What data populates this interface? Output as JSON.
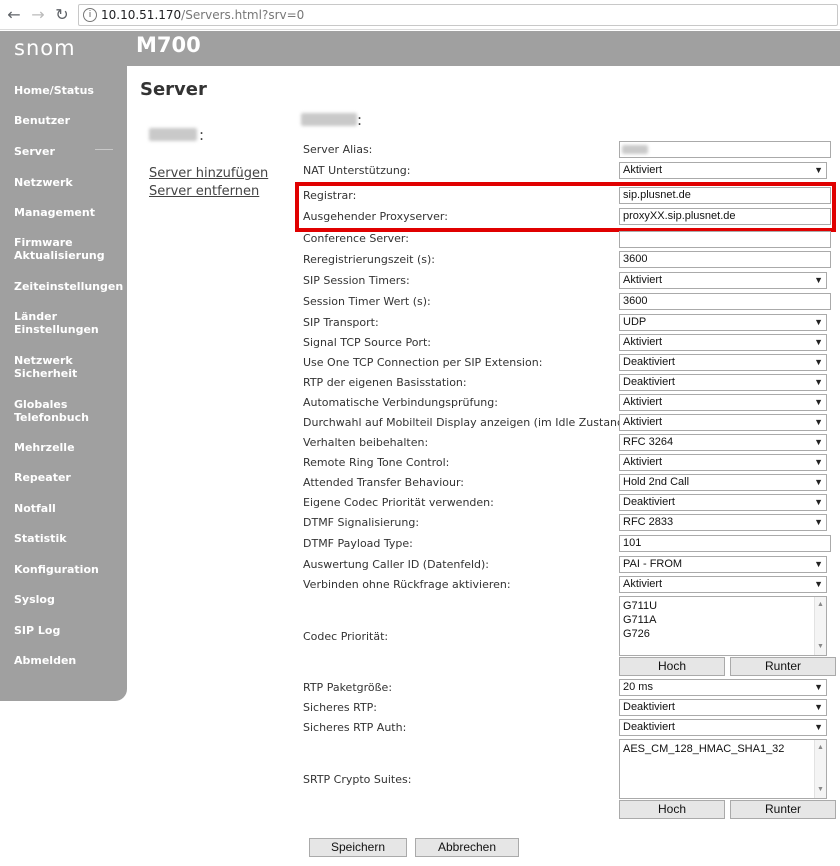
{
  "browser": {
    "back_icon": "arrow-left-icon",
    "forward_icon": "arrow-right-icon",
    "reload_icon": "reload-icon",
    "url_host": "10.10.51.170",
    "url_path": "/Servers.html?srv=0"
  },
  "header": {
    "logo": "snom",
    "model": "M700"
  },
  "sidebar": {
    "items": [
      {
        "label": "Home/Status"
      },
      {
        "label": "Benutzer"
      },
      {
        "label": "Server"
      },
      {
        "label": "Netzwerk"
      },
      {
        "label": "Management"
      },
      {
        "label": "Firmware",
        "label2": "Aktualisierung"
      },
      {
        "label": "Zeiteinstellungen"
      },
      {
        "label": "Länder",
        "label2": "Einstellungen"
      },
      {
        "label": "Netzwerk",
        "label2": "Sicherheit"
      },
      {
        "label": "Globales",
        "label2": "Telefonbuch"
      },
      {
        "label": "Mehrzelle"
      },
      {
        "label": "Repeater"
      },
      {
        "label": "Notfall"
      },
      {
        "label": "Statistik"
      },
      {
        "label": "Konfiguration"
      },
      {
        "label": "Syslog"
      },
      {
        "label": "SIP Log"
      },
      {
        "label": "Abmelden"
      }
    ]
  },
  "main": {
    "title": "Server",
    "links": {
      "add": "Server hinzufügen",
      "remove": "Server entfernen"
    },
    "colon": ":",
    "rows": {
      "server_alias": {
        "label": "Server Alias:",
        "value": ""
      },
      "nat": {
        "label": "NAT Unterstützung:",
        "value": "Aktiviert"
      },
      "registrar": {
        "label": "Registrar:",
        "value": "sip.plusnet.de"
      },
      "proxy": {
        "label": "Ausgehender Proxyserver:",
        "value": "proxyXX.sip.plusnet.de"
      },
      "conference": {
        "label": "Conference Server:",
        "value": ""
      },
      "rereg": {
        "label": "Reregistrierungszeit (s):",
        "value": "3600"
      },
      "sip_session_timers": {
        "label": "SIP Session Timers:",
        "value": "Aktiviert"
      },
      "session_timer_value": {
        "label": "Session Timer Wert (s):",
        "value": "3600"
      },
      "sip_transport": {
        "label": "SIP Transport:",
        "value": "UDP"
      },
      "tcp_source_port": {
        "label": "Signal TCP Source Port:",
        "value": "Aktiviert"
      },
      "one_tcp": {
        "label": "Use One TCP Connection per SIP Extension:",
        "value": "Deaktiviert"
      },
      "rtp_base": {
        "label": "RTP der eigenen Basisstation:",
        "value": "Deaktiviert"
      },
      "auto_check": {
        "label": "Automatische Verbindungsprüfung:",
        "value": "Aktiviert"
      },
      "durchwahl": {
        "label": "Durchwahl auf Mobilteil Display anzeigen (im Idle Zustand):",
        "value": "Aktiviert"
      },
      "verhalten": {
        "label": "Verhalten beibehalten:",
        "value": "RFC 3264"
      },
      "remote_ring": {
        "label": "Remote Ring Tone Control:",
        "value": "Aktiviert"
      },
      "attended": {
        "label": "Attended Transfer Behaviour:",
        "value": "Hold 2nd Call"
      },
      "codec_prio_own": {
        "label": "Eigene Codec Priorität verwenden:",
        "value": "Deaktiviert"
      },
      "dtmf_sig": {
        "label": "DTMF Signalisierung:",
        "value": "RFC 2833"
      },
      "dtmf_payload": {
        "label": "DTMF Payload Type:",
        "value": "101"
      },
      "caller_id": {
        "label": "Auswertung Caller ID (Datenfeld):",
        "value": "PAI - FROM"
      },
      "connect": {
        "label": "Verbinden ohne Rückfrage aktivieren:",
        "value": "Aktiviert"
      },
      "codec_prio": {
        "label": "Codec Priorität:",
        "options": [
          "G711U",
          "G711A",
          "G726"
        ]
      },
      "rtp_packet": {
        "label": "RTP Paketgröße:",
        "value": "20 ms"
      },
      "srtp": {
        "label": "Sicheres RTP:",
        "value": "Deaktiviert"
      },
      "srtp_auth": {
        "label": "Sicheres RTP Auth:",
        "value": "Deaktiviert"
      },
      "srtp_suites": {
        "label": "SRTP Crypto Suites:",
        "options": [
          "AES_CM_128_HMAC_SHA1_32"
        ]
      }
    },
    "buttons": {
      "hoch": "Hoch",
      "runter": "Runter",
      "save": "Speichern",
      "cancel": "Abbrechen"
    }
  },
  "colors": {
    "highlight": "#e00000",
    "sidebar": "#a0a0a0"
  }
}
